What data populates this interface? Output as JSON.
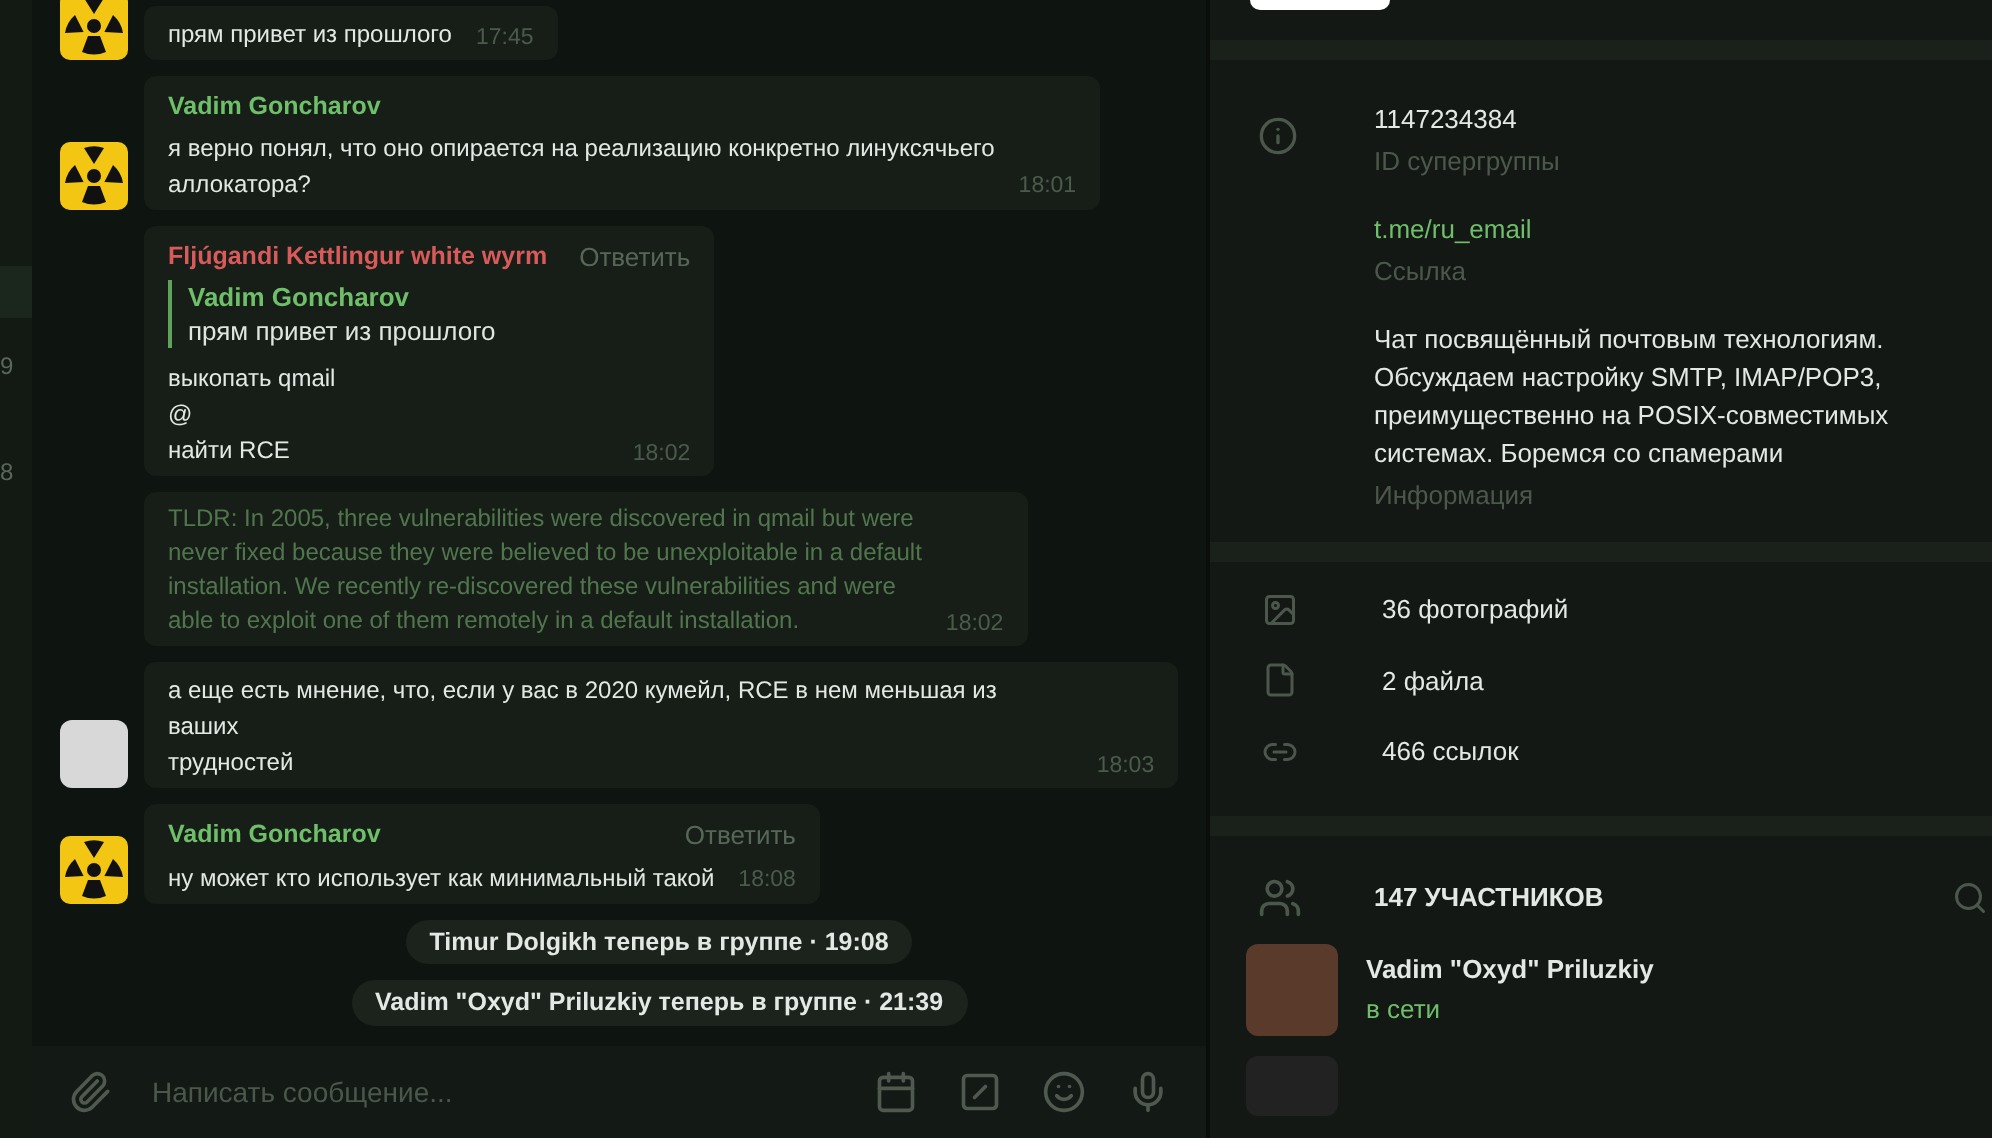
{
  "sidebar_strip": {
    "items": [
      {
        "text": "9"
      },
      {
        "text": "8"
      }
    ]
  },
  "messages": [
    {
      "kind": "message",
      "avatar": {
        "kind": "radiation"
      },
      "text": [
        "прям привет из прошлого"
      ],
      "time": "17:45"
    },
    {
      "kind": "message",
      "avatar": {
        "kind": "radiation"
      },
      "sender": "Vadim Goncharov",
      "color": "#6fbf6a",
      "text": [
        "я верно понял, что оно опирается на реализацию конкретно линуксячьего",
        "аллокатора?"
      ],
      "time": "18:01"
    },
    {
      "kind": "message",
      "sender": "Fljúgandi Kettlingur white wyrm",
      "color": "#d95a5a",
      "reply_action": "Ответить",
      "quote": {
        "sender": "Vadim Goncharov",
        "text": "прям привет из прошлого"
      },
      "text": [
        "выкопать qmail",
        "@",
        "найти RCE"
      ],
      "time": "18:02"
    },
    {
      "kind": "quoted_text",
      "text": [
        "TLDR: In 2005, three vulnerabilities were discovered in qmail but were",
        "never fixed because they were believed to be unexploitable in a default",
        "installation. We recently re-discovered these vulnerabilities and were",
        "able to exploit one of them remotely in a default installation."
      ],
      "time": "18:02"
    },
    {
      "kind": "message",
      "avatar": {
        "kind": "photo"
      },
      "text": [
        "а еще есть мнение, что, если у вас в 2020 кумейл, RCE в нем меньшая из ваших",
        "трудностей"
      ],
      "time": "18:03"
    },
    {
      "kind": "message",
      "avatar": {
        "kind": "radiation"
      },
      "sender": "Vadim Goncharov",
      "color": "#6fbf6a",
      "reply_action": "Ответить",
      "text": [
        "ну может кто использует как минимальный такой"
      ],
      "time": "18:08"
    },
    {
      "kind": "service",
      "text": "Timur Dolgikh теперь в группе · 19:08"
    },
    {
      "kind": "service",
      "text": "Vadim \"Oxyd\" Priluzkiy теперь в группе · 21:39"
    }
  ],
  "composer": {
    "placeholder": "Написать сообщение..."
  },
  "info": {
    "rows": [
      {
        "value": "1147234384",
        "label": "ID супергруппы",
        "link": false
      },
      {
        "value": "t.me/ru_email",
        "label": "Ссылка",
        "link": true
      },
      {
        "value": "Чат посвящённый почтовым технологиям. Обсуждаем настройку SMTP, IMAP/POP3, преимущественно на POSIX-совместимых системах. Боремся со спамерами",
        "label": "Информация",
        "link": false
      }
    ]
  },
  "media": [
    {
      "kind": "photos",
      "text": "36 фотографий"
    },
    {
      "kind": "files",
      "text": "2 файла"
    },
    {
      "kind": "links",
      "text": "466 ссылок"
    }
  ],
  "members": {
    "title": "147 УЧАСТНИКОВ",
    "list": [
      {
        "name": "Vadim \"Oxyd\" Priluzkiy",
        "status": "в сети",
        "online": true
      }
    ]
  }
}
